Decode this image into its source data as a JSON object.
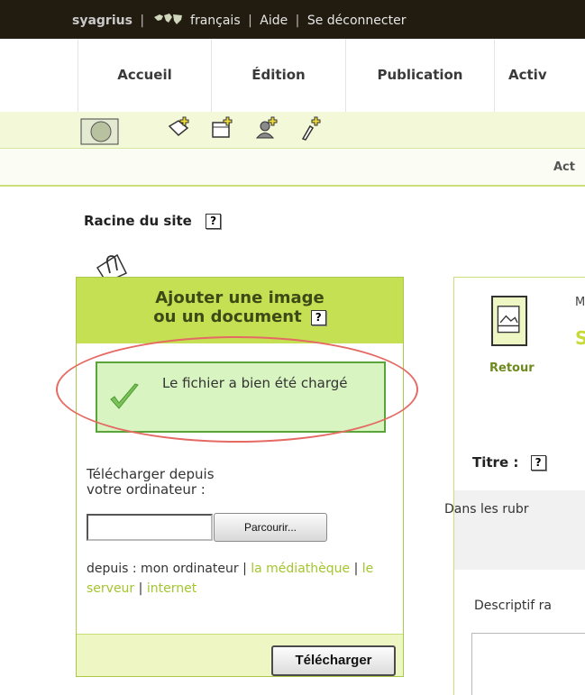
{
  "topbar": {
    "user": "syagrius",
    "separator": "|",
    "language": "français",
    "help": "Aide",
    "logout": "Se déconnecter"
  },
  "nav": {
    "items": [
      {
        "label": "Accueil"
      },
      {
        "label": "Édition"
      },
      {
        "label": "Publication"
      },
      {
        "label": "Activ"
      }
    ]
  },
  "toolbar": {
    "icons": [
      "site-map-icon",
      "new-article-icon",
      "new-section-icon",
      "new-author-icon",
      "new-keyword-icon"
    ]
  },
  "subbar": {
    "text": "Act"
  },
  "racine": {
    "label": "Racine du site",
    "help": "?"
  },
  "upload_panel": {
    "title_line1": "Ajouter une image",
    "title_line2": "ou un document",
    "help": "?",
    "success_message": "Le fichier a bien été chargé",
    "upload_label_line1": "Télécharger depuis",
    "upload_label_line2": "votre ordinateur :",
    "file_value": "",
    "browse_label": "Parcourir...",
    "sources_prefix": "depuis : mon ordinateur |",
    "source_mediatheque": "la médiathèque",
    "sep": "|",
    "source_serveur": "le serveur",
    "source_internet": "internet",
    "submit_label": "Télécharger"
  },
  "right_panel": {
    "back_label": "Retour",
    "truncated_top": "M",
    "truncated_title": "S",
    "titre_label": "Titre :",
    "titre_help": "?",
    "dans_label": "Dans les rubr",
    "descriptif_label": "Descriptif ra"
  },
  "colors": {
    "accent_green": "#c5e052",
    "link_green": "#a3c52e",
    "success_border": "#5aa43a",
    "highlight_ellipse": "#e56a63"
  }
}
